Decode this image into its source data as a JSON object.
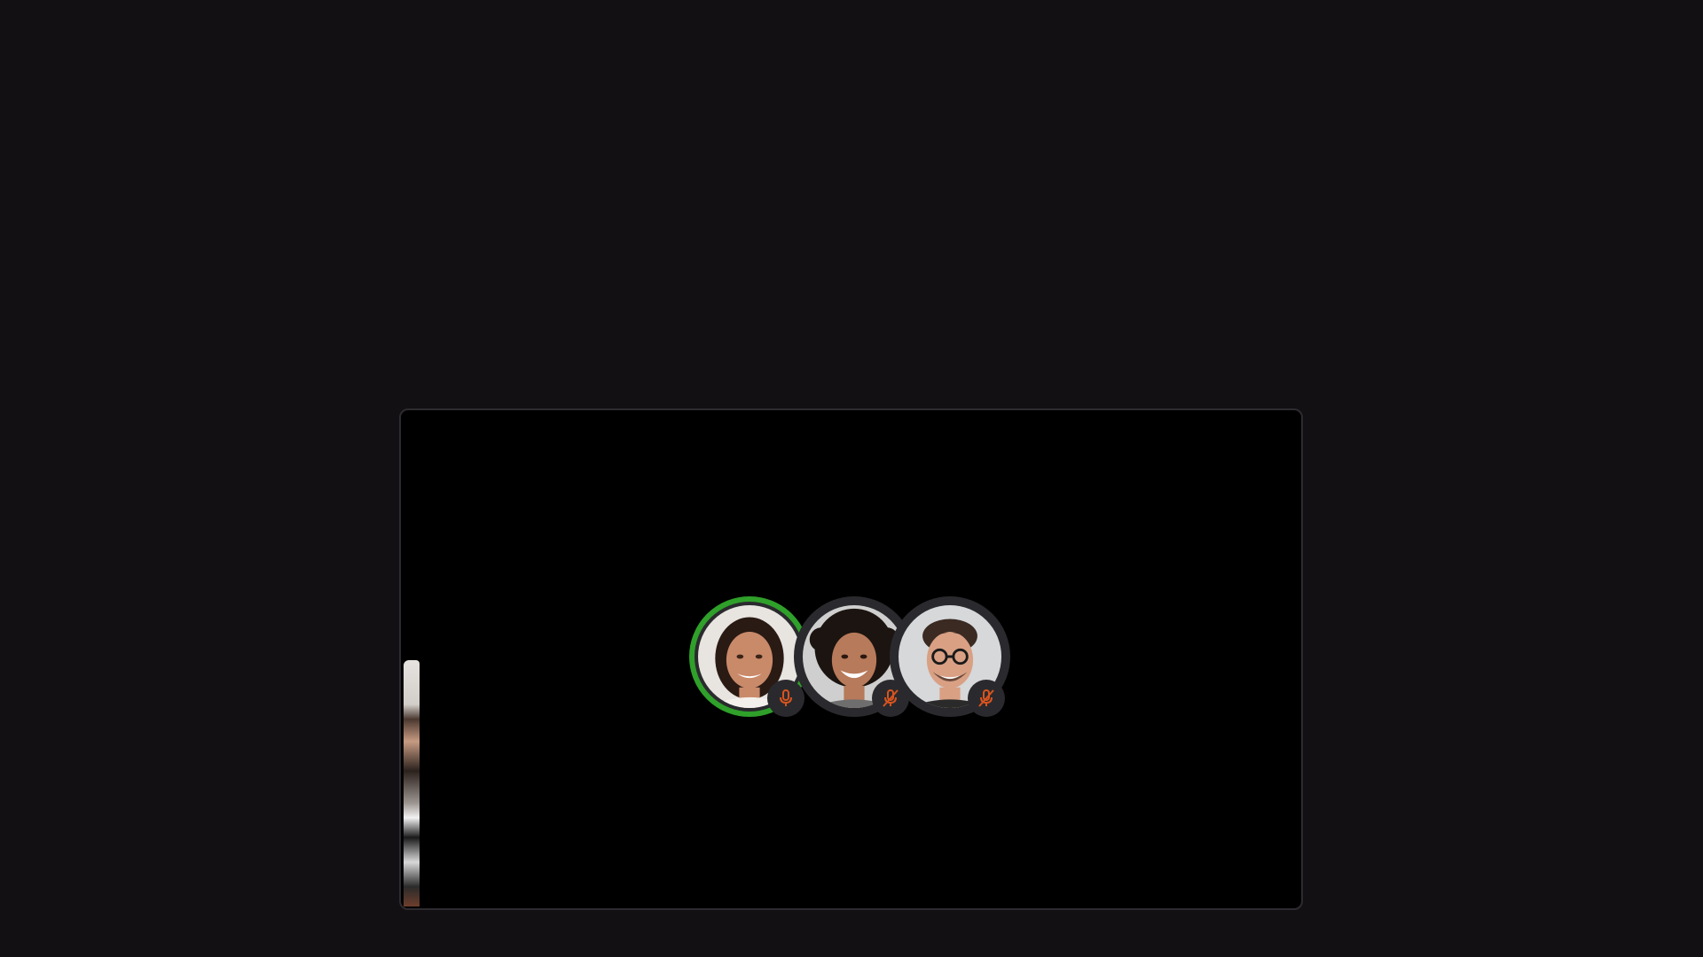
{
  "colors": {
    "background": "#131014",
    "call_window": "#000000",
    "speaking_ring": "#2fa02a",
    "mic_icon": "#d9541e",
    "badge": "#2a2a2e"
  },
  "participants": [
    {
      "speaking": true,
      "mic": "mic-icon"
    },
    {
      "speaking": false,
      "mic": "mic-muted-icon"
    },
    {
      "speaking": false,
      "mic": "mic-muted-icon"
    }
  ]
}
